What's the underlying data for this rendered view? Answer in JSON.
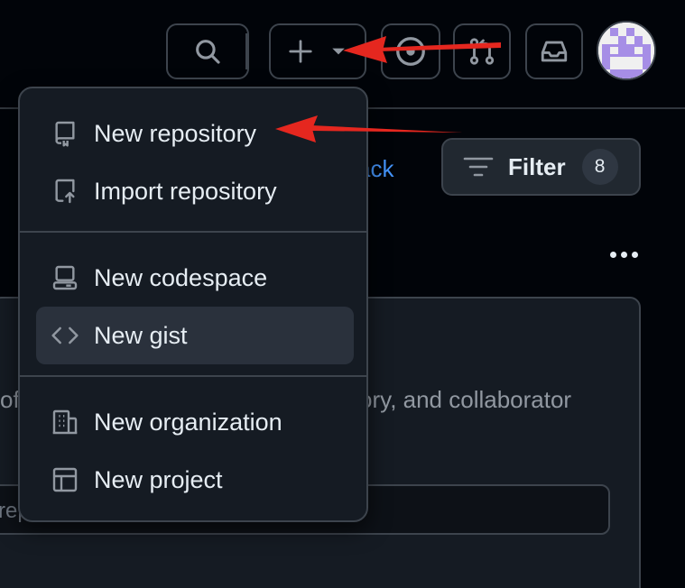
{
  "header": {
    "search_icon": "search-icon",
    "create_icon": "plus-icon",
    "create_caret_icon": "triangle-down-icon",
    "issues_icon": "issue-opened-icon",
    "pulls_icon": "git-pull-request-icon",
    "inbox_icon": "inbox-icon",
    "avatar_icon": "identicon-avatar"
  },
  "background": {
    "link_text": "ack",
    "filter_label": "Filter",
    "filter_count": "8",
    "panel_text_left": "of",
    "panel_text_right": "ory, and collaborator",
    "input_placeholder": "rep"
  },
  "menu": {
    "items": [
      {
        "label": "New repository",
        "icon": "repo-icon"
      },
      {
        "label": "Import repository",
        "icon": "repo-push-icon"
      },
      {
        "label": "New codespace",
        "icon": "codespaces-icon"
      },
      {
        "label": "New gist",
        "icon": "code-icon"
      },
      {
        "label": "New organization",
        "icon": "organization-icon"
      },
      {
        "label": "New project",
        "icon": "table-icon"
      }
    ]
  },
  "colors": {
    "background": "#010409",
    "menu_bg": "#151b23",
    "border": "#3d444d",
    "text": "#e6edf3",
    "link": "#4493f8",
    "annotation_arrow": "#e5271f",
    "avatar_purple": "#a68ee6"
  }
}
